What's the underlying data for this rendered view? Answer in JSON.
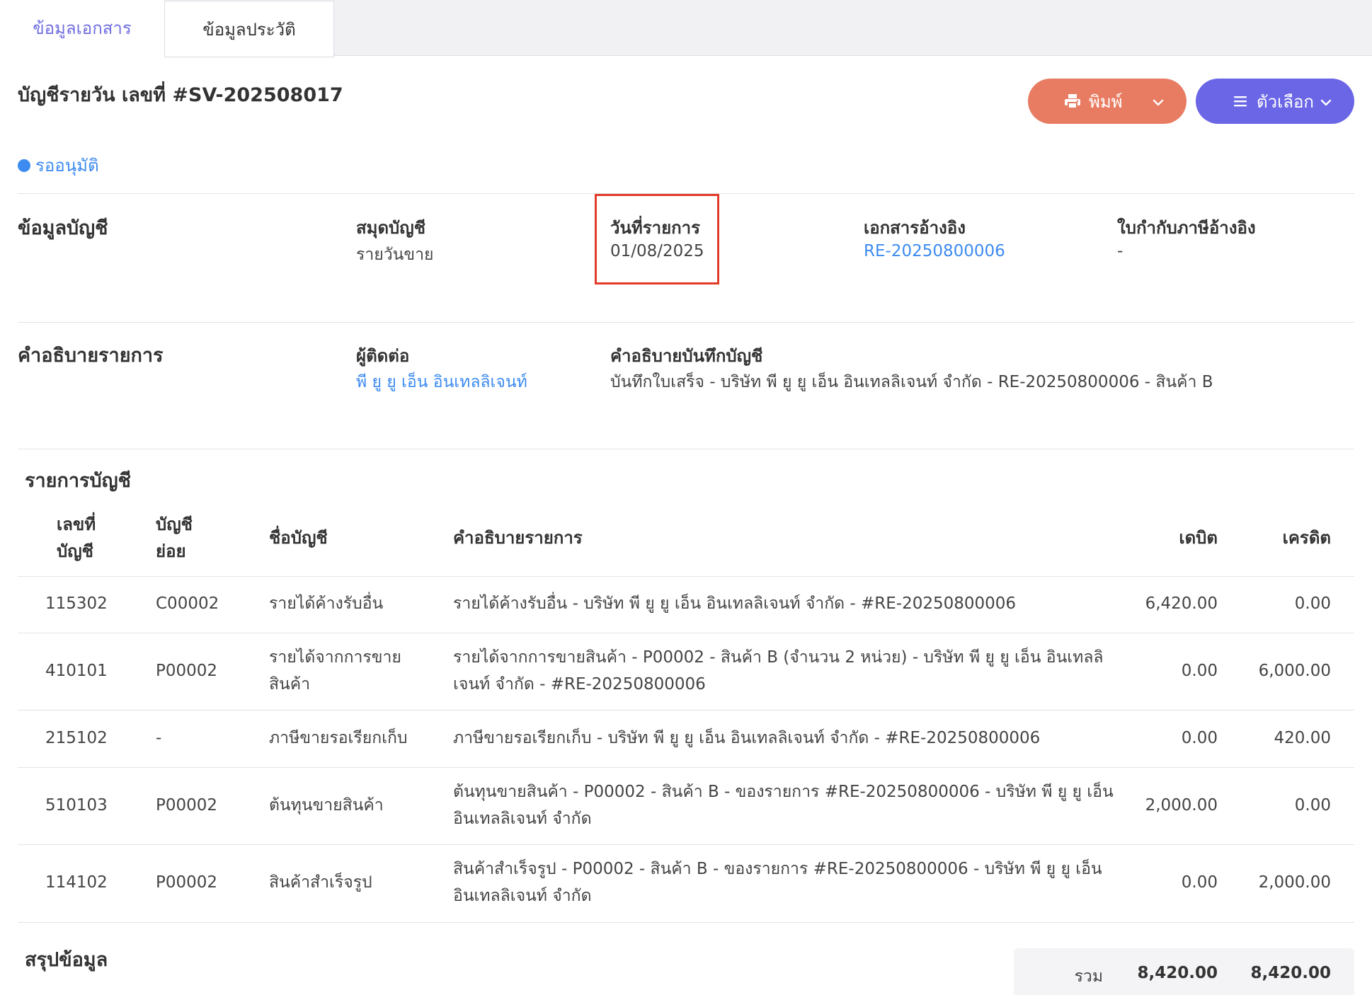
{
  "tabs": {
    "document_info": "ข้อมูลเอกสาร",
    "history": "ข้อมูลประวัติ"
  },
  "header": {
    "title": "บัญชีรายวัน เลขที่ #SV-202508017",
    "print_button": "พิมพ์",
    "options_button": "ตัวเลือก"
  },
  "status": {
    "label": "รออนุมัติ",
    "color": "#3d8bf0"
  },
  "account_info": {
    "section_title": "ข้อมูลบัญชี",
    "journal_book_label": "สมุดบัญชี",
    "journal_book_value": "รายวันขาย",
    "transaction_date_label": "วันที่รายการ",
    "transaction_date_value": "01/08/2025",
    "reference_doc_label": "เอกสารอ้างอิง",
    "reference_doc_value": "RE-20250800006",
    "tax_invoice_ref_label": "ใบกำกับภาษีอ้างอิง",
    "tax_invoice_ref_value": "-"
  },
  "description_info": {
    "section_title": "คำอธิบายรายการ",
    "contact_label": "ผู้ติดต่อ",
    "contact_value": "พี ยู ยู เอ็น อินเทลลิเจนท์",
    "journal_desc_label": "คำอธิบายบันทึกบัญชี",
    "journal_desc_value": "บันทึกใบเสร็จ - บริษัท พี ยู ยู เอ็น อินเทลลิเจนท์ จำกัด - RE-20250800006 - สินค้า B"
  },
  "entries": {
    "section_title": "รายการบัญชี",
    "columns": {
      "account_no_line1": "เลขที่",
      "account_no_line2": "บัญชี",
      "sub_account_line1": "บัญชี",
      "sub_account_line2": "ย่อย",
      "account_name": "ชื่อบัญชี",
      "description": "คำอธิบายรายการ",
      "debit": "เดบิต",
      "credit": "เครดิต"
    },
    "rows": [
      {
        "account_no": "115302",
        "sub_account": "C00002",
        "name_line1": "รายได้ค้างรับอื่น",
        "name_line2": "",
        "desc_line1": "รายได้ค้างรับอื่น - บริษัท พี ยู ยู เอ็น อินเทลลิเจนท์ จำกัด - #RE-20250800006",
        "desc_line2": "",
        "debit": "6,420.00",
        "credit": "0.00"
      },
      {
        "account_no": "410101",
        "sub_account": "P00002",
        "name_line1": "รายได้จากการขาย",
        "name_line2": "สินค้า",
        "desc_line1": "รายได้จากการขายสินค้า - P00002 - สินค้า B (จำนวน 2 หน่วย) - บริษัท พี ยู ยู เอ็น อินเทลลิ",
        "desc_line2": "เจนท์ จำกัด - #RE-20250800006",
        "debit": "0.00",
        "credit": "6,000.00"
      },
      {
        "account_no": "215102",
        "sub_account": "-",
        "name_line1": "ภาษีขายรอเรียกเก็บ",
        "name_line2": "",
        "desc_line1": "ภาษีขายรอเรียกเก็บ - บริษัท พี ยู ยู เอ็น อินเทลลิเจนท์ จำกัด - #RE-20250800006",
        "desc_line2": "",
        "debit": "0.00",
        "credit": "420.00"
      },
      {
        "account_no": "510103",
        "sub_account": "P00002",
        "name_line1": "ต้นทุนขายสินค้า",
        "name_line2": "",
        "desc_line1": "ต้นทุนขายสินค้า - P00002 - สินค้า B - ของรายการ #RE-20250800006 - บริษัท พี ยู ยู เอ็น",
        "desc_line2": "อินเทลลิเจนท์ จำกัด",
        "debit": "2,000.00",
        "credit": "0.00"
      },
      {
        "account_no": "114102",
        "sub_account": "P00002",
        "name_line1": "สินค้าสำเร็จรูป",
        "name_line2": "",
        "desc_line1": "สินค้าสำเร็จรูป - P00002 - สินค้า B - ของรายการ #RE-20250800006 - บริษัท พี ยู ยู เอ็น",
        "desc_line2": "อินเทลลิเจนท์ จำกัด",
        "debit": "0.00",
        "credit": "2,000.00"
      }
    ]
  },
  "summary": {
    "section_title": "สรุปข้อมูล",
    "total_label": "รวม",
    "total_debit": "8,420.00",
    "total_credit": "8,420.00"
  },
  "icons": {
    "print": "printer-icon",
    "options": "menu-icon",
    "dropdown": "chevron-down-icon"
  }
}
